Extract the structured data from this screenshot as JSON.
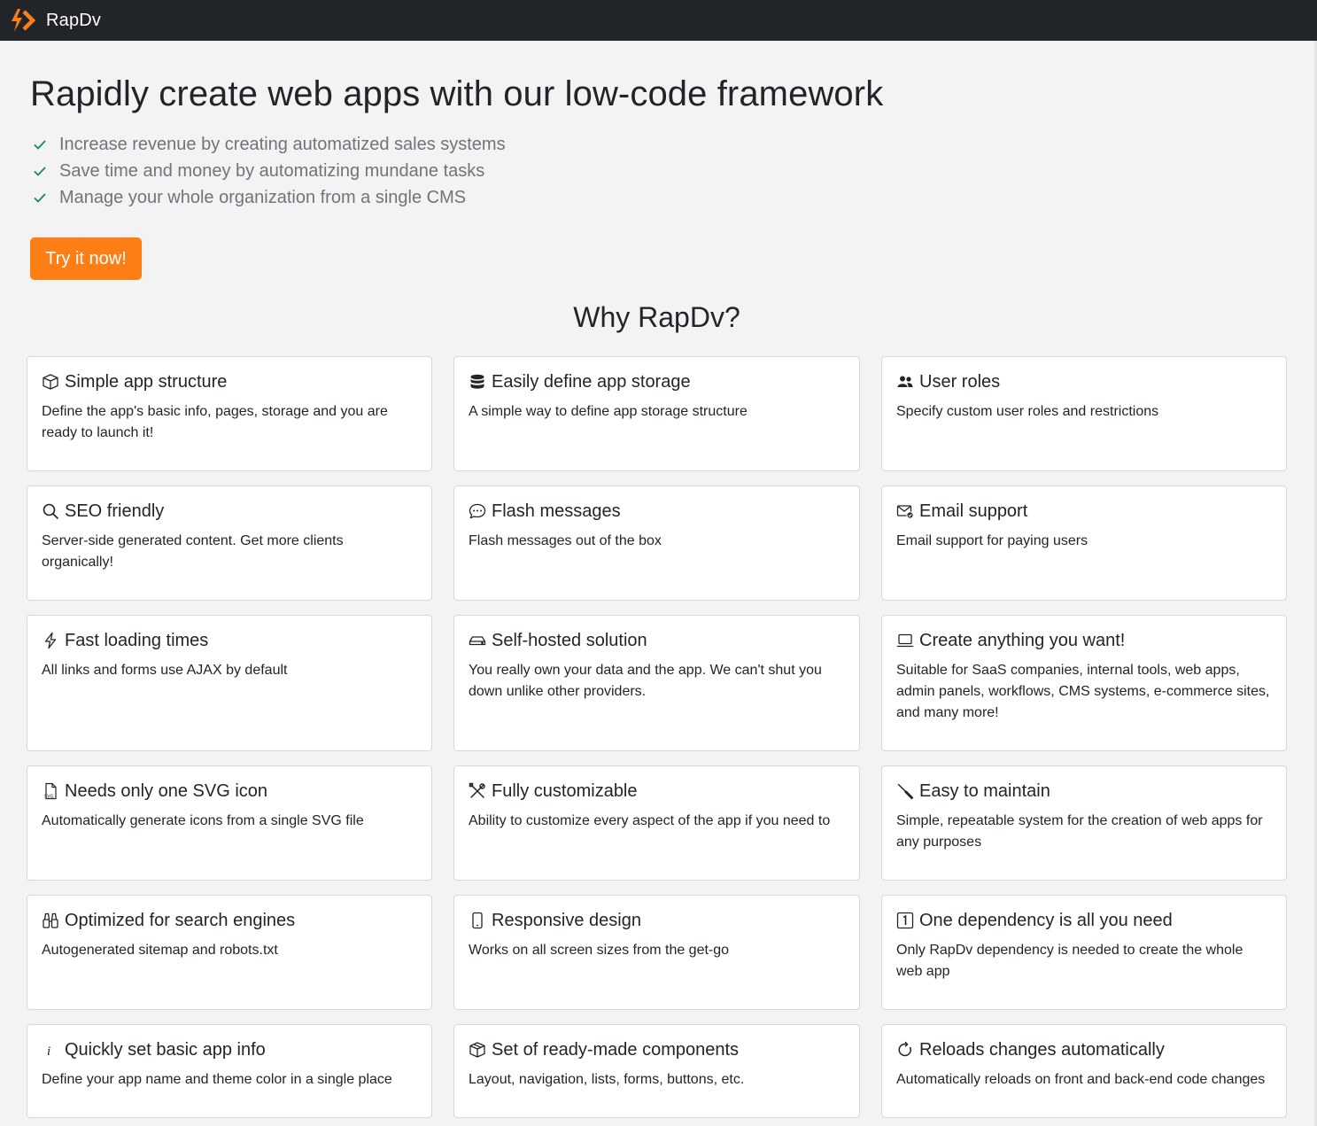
{
  "navbar": {
    "brand_name": "RapDv",
    "brand_icon": "logo-bolt-chevron-icon",
    "brand_color": "#fd7e14"
  },
  "hero": {
    "title": "Rapidly create web apps with our low-code framework",
    "benefits": [
      "Increase revenue by creating automatized sales systems",
      "Save time and money by automatizing mundane tasks",
      "Manage your whole organization from a single CMS"
    ],
    "cta_label": "Try it now!",
    "cta_color": "#fd7e14",
    "check_color": "#198754"
  },
  "features": {
    "heading": "Why RapDv?",
    "items": [
      {
        "icon": "box-icon",
        "title": "Simple app structure",
        "text": "Define the app's basic info, pages, storage and you are ready to launch it!"
      },
      {
        "icon": "database-icon",
        "title": "Easily define app storage",
        "text": "A simple way to define app storage structure"
      },
      {
        "icon": "people-icon",
        "title": "User roles",
        "text": "Specify custom user roles and restrictions"
      },
      {
        "icon": "search-icon",
        "title": "SEO friendly",
        "text": "Server-side generated content. Get more clients organically!"
      },
      {
        "icon": "chat-dots-icon",
        "title": "Flash messages",
        "text": "Flash messages out of the box"
      },
      {
        "icon": "envelope-check-icon",
        "title": "Email support",
        "text": "Email support for paying users"
      },
      {
        "icon": "lightning-icon",
        "title": "Fast loading times",
        "text": "All links and forms use AJAX by default"
      },
      {
        "icon": "hdd-icon",
        "title": "Self-hosted solution",
        "text": "You really own your data and the app. We can't shut you down unlike other providers."
      },
      {
        "icon": "laptop-icon",
        "title": "Create anything you want!",
        "text": "Suitable for SaaS companies, internal tools, web apps, admin panels, workflows, CMS systems, e-commerce sites, and many more!"
      },
      {
        "icon": "file-svg-icon",
        "title": "Needs only one SVG icon",
        "text": "Automatically generate icons from a single SVG file"
      },
      {
        "icon": "tools-icon",
        "title": "Fully customizable",
        "text": "Ability to customize every aspect of the app if you need to"
      },
      {
        "icon": "screwdriver-icon",
        "title": "Easy to maintain",
        "text": "Simple, repeatable system for the creation of web apps for any purposes"
      },
      {
        "icon": "binoculars-icon",
        "title": "Optimized for search engines",
        "text": "Autogenerated sitemap and robots.txt"
      },
      {
        "icon": "phone-icon",
        "title": "Responsive design",
        "text": "Works on all screen sizes from the get-go"
      },
      {
        "icon": "one-square-icon",
        "title": "One dependency is all you need",
        "text": "Only RapDv dependency is needed to create the whole web app"
      },
      {
        "icon": "info-icon",
        "title": "Quickly set basic app info",
        "text": "Define your app name and theme color in a single place"
      },
      {
        "icon": "boxes-icon",
        "title": "Set of ready-made components",
        "text": "Layout, navigation, lists, forms, buttons, etc."
      },
      {
        "icon": "arrow-clockwise-icon",
        "title": "Reloads changes automatically",
        "text": "Automatically reloads on front and back-end code changes"
      }
    ]
  }
}
